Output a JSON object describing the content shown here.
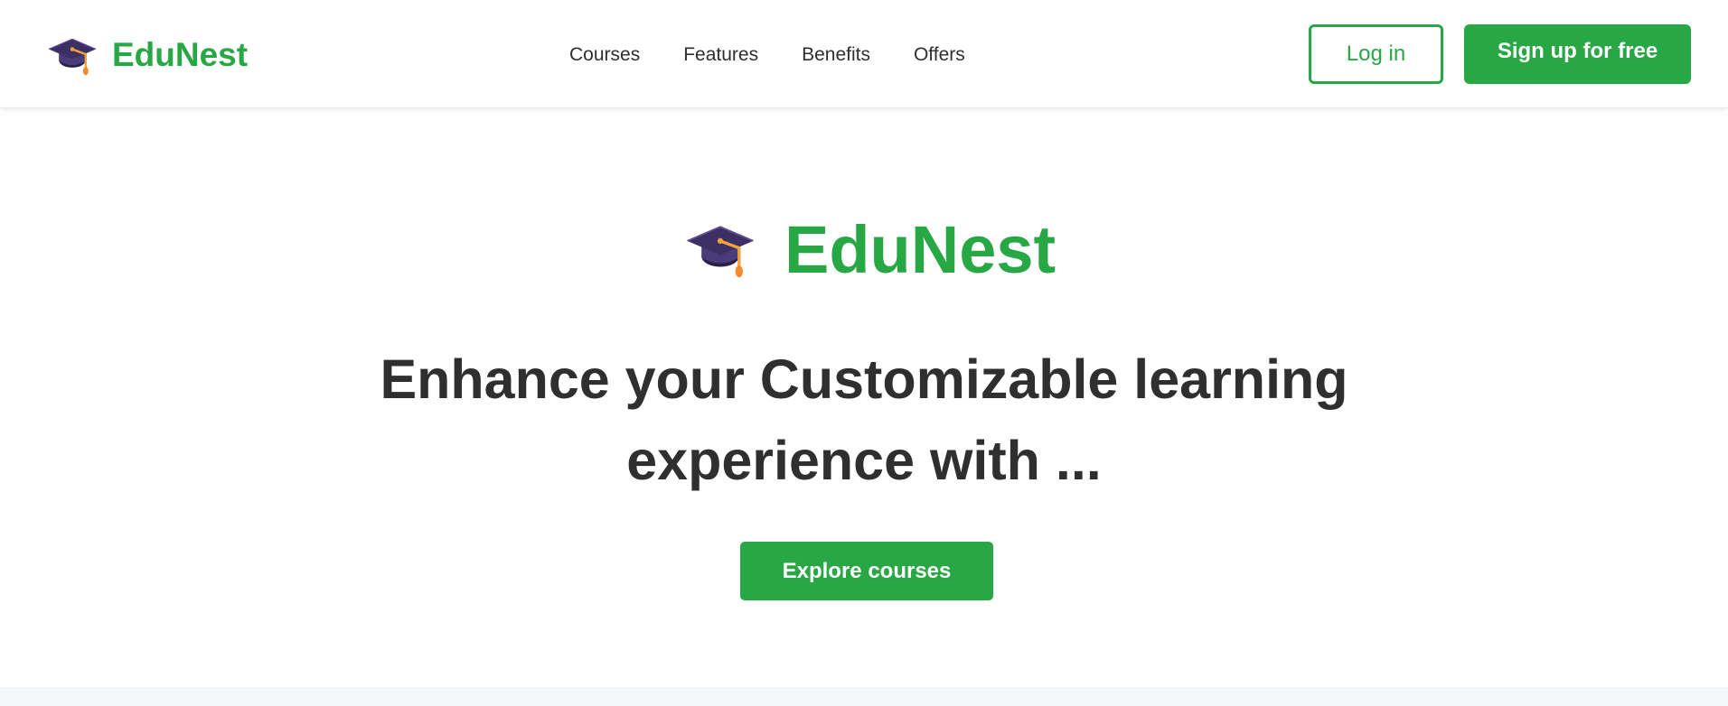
{
  "header": {
    "brand": {
      "name": "EduNest",
      "icon": "graduation-cap-icon"
    },
    "nav": [
      {
        "label": "Courses"
      },
      {
        "label": "Features"
      },
      {
        "label": "Benefits"
      },
      {
        "label": "Offers"
      }
    ],
    "login_label": "Log in",
    "signup_label": "Sign up for free"
  },
  "hero": {
    "brand_name": "EduNest",
    "icon": "graduation-cap-icon",
    "title_line1": "Enhance your Customizable learning",
    "title_line2": "experience with ...",
    "cta_label": "Explore courses"
  },
  "colors": {
    "accent": "#28a745",
    "text": "#2f2f2f",
    "background": "#ffffff",
    "cap_dark": "#3b2f63",
    "tassel": "#f2a33a"
  }
}
